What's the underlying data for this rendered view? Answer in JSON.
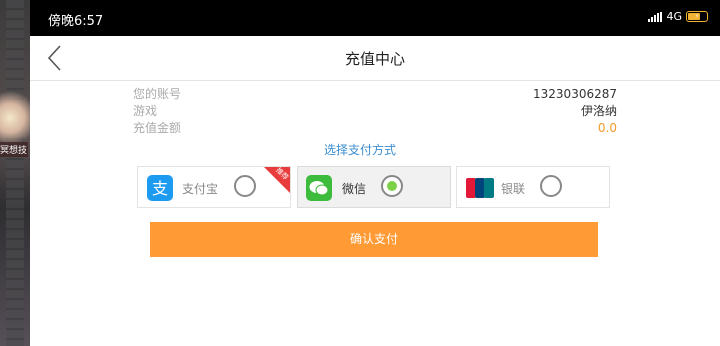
{
  "status_bar": {
    "time": "傍晚6:57",
    "network": "4G"
  },
  "game_overlay": {
    "label": "冥想技"
  },
  "header": {
    "title": "充值中心"
  },
  "account_info": [
    {
      "key": "您的账号",
      "value": "13230306287"
    },
    {
      "key": "游戏",
      "value": "伊洛纳"
    },
    {
      "key": "充值金额",
      "value": "0.0"
    }
  ],
  "payment": {
    "prompt": "选择支付方式",
    "methods": [
      {
        "name": "alipay",
        "label": "支付宝",
        "badge": "推荐",
        "selected": false,
        "icon": "alipay-icon"
      },
      {
        "name": "wechat",
        "label": "微信",
        "selected": true,
        "icon": "wechat-icon"
      },
      {
        "name": "unionpay",
        "label": "银联",
        "selected": false,
        "icon": "unionpay-icon"
      }
    ]
  },
  "confirm_label": "确认支付",
  "colors": {
    "accent": "#ff9a34",
    "link": "#3b8ed1",
    "amount": "#f39a2b",
    "badge": "#e83b3b",
    "selected_dot": "#7dd147"
  }
}
